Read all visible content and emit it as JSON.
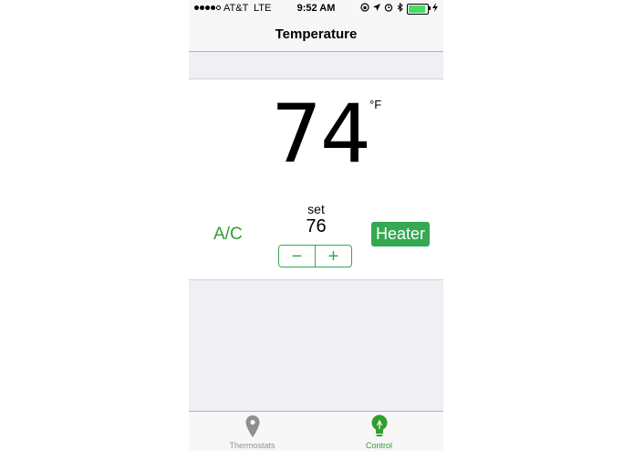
{
  "status_bar": {
    "carrier": "AT&T",
    "network": "LTE",
    "time": "9:52 AM",
    "icons": [
      "signal-dots-icon",
      "rotation-lock-icon",
      "location-arrow-icon",
      "alarm-clock-icon",
      "bluetooth-icon",
      "battery-icon",
      "charging-bolt-icon"
    ],
    "battery_level": 0.9
  },
  "nav": {
    "title": "Temperature"
  },
  "current": {
    "temperature": "74",
    "unit": "°F"
  },
  "setpoint": {
    "label": "set",
    "value": "76",
    "minus": "−",
    "plus": "+"
  },
  "modes": {
    "ac_label": "A/C",
    "heater_label": "Heater",
    "active": "Heater"
  },
  "tabs": [
    {
      "label": "Thermostats",
      "icon": "map-pin-icon",
      "selected": false
    },
    {
      "label": "Control",
      "icon": "lightbulb-icon",
      "selected": true
    }
  ],
  "colors": {
    "accent": "#34a853",
    "tab_inactive": "#929292",
    "background": "#f0eff4"
  }
}
